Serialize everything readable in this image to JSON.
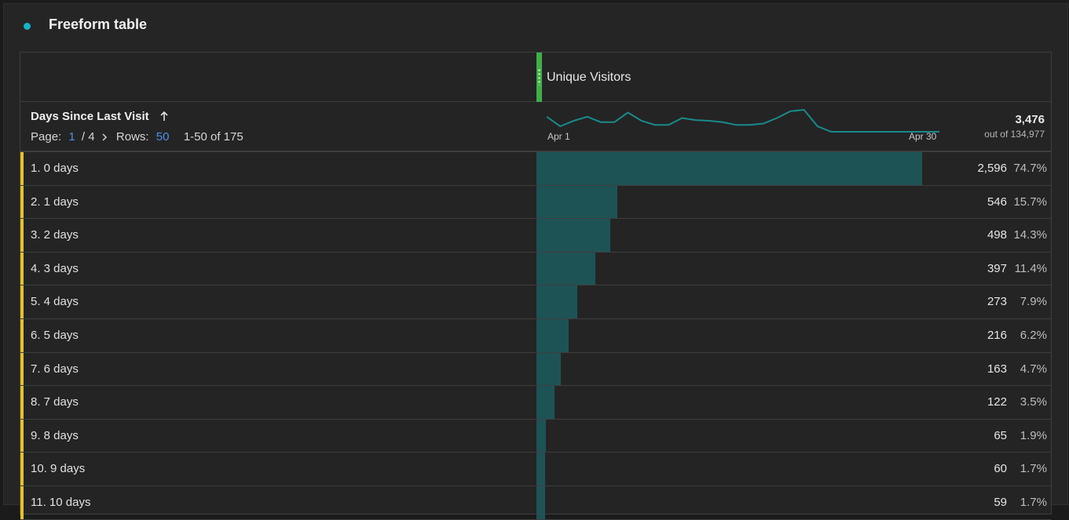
{
  "panel": {
    "title": "Freeform table",
    "status_color": "#14b3c8"
  },
  "metric": {
    "title": "Unique Visitors",
    "handle_color": "#3fae49"
  },
  "dimension": {
    "title": "Days Since Last Visit",
    "sort_icon": "arrow-up-icon"
  },
  "pager": {
    "page_label": "Page:",
    "current_page": "1",
    "total_pages": "/ 4",
    "rows_label": "Rows:",
    "rows_value": "50",
    "range": "1-50 of 175"
  },
  "sparkline": {
    "start_label": "Apr 1",
    "end_label": "Apr 30",
    "values": [
      62,
      48,
      56,
      62,
      54,
      54,
      68,
      56,
      50,
      50,
      60,
      57,
      56,
      54,
      50,
      50,
      52,
      60,
      70,
      72,
      48,
      40,
      40,
      40,
      40,
      40,
      40,
      40,
      40,
      40
    ],
    "color": "#1b8a8a"
  },
  "total": {
    "value": "3,476",
    "out_of": "out of 134,977"
  },
  "rows": [
    {
      "label": "1.  0 days",
      "value": "2,596",
      "pct": "74.7%",
      "share": 0.747
    },
    {
      "label": "2.  1 days",
      "value": "546",
      "pct": "15.7%",
      "share": 0.157
    },
    {
      "label": "3.  2 days",
      "value": "498",
      "pct": "14.3%",
      "share": 0.143
    },
    {
      "label": "4.  3 days",
      "value": "397",
      "pct": "11.4%",
      "share": 0.114
    },
    {
      "label": "5.  4 days",
      "value": "273",
      "pct": "7.9%",
      "share": 0.079
    },
    {
      "label": "6.  5 days",
      "value": "216",
      "pct": "6.2%",
      "share": 0.062
    },
    {
      "label": "7.  6 days",
      "value": "163",
      "pct": "4.7%",
      "share": 0.047
    },
    {
      "label": "8.  7 days",
      "value": "122",
      "pct": "3.5%",
      "share": 0.035
    },
    {
      "label": "9.  8 days",
      "value": "65",
      "pct": "1.9%",
      "share": 0.019
    },
    {
      "label": "10.  9 days",
      "value": "60",
      "pct": "1.7%",
      "share": 0.017
    },
    {
      "label": "11.  10 days",
      "value": "59",
      "pct": "1.7%",
      "share": 0.017
    }
  ],
  "colors": {
    "bar": "#1e5356",
    "row_accent": "#e6c229",
    "link": "#4d8fe6"
  }
}
